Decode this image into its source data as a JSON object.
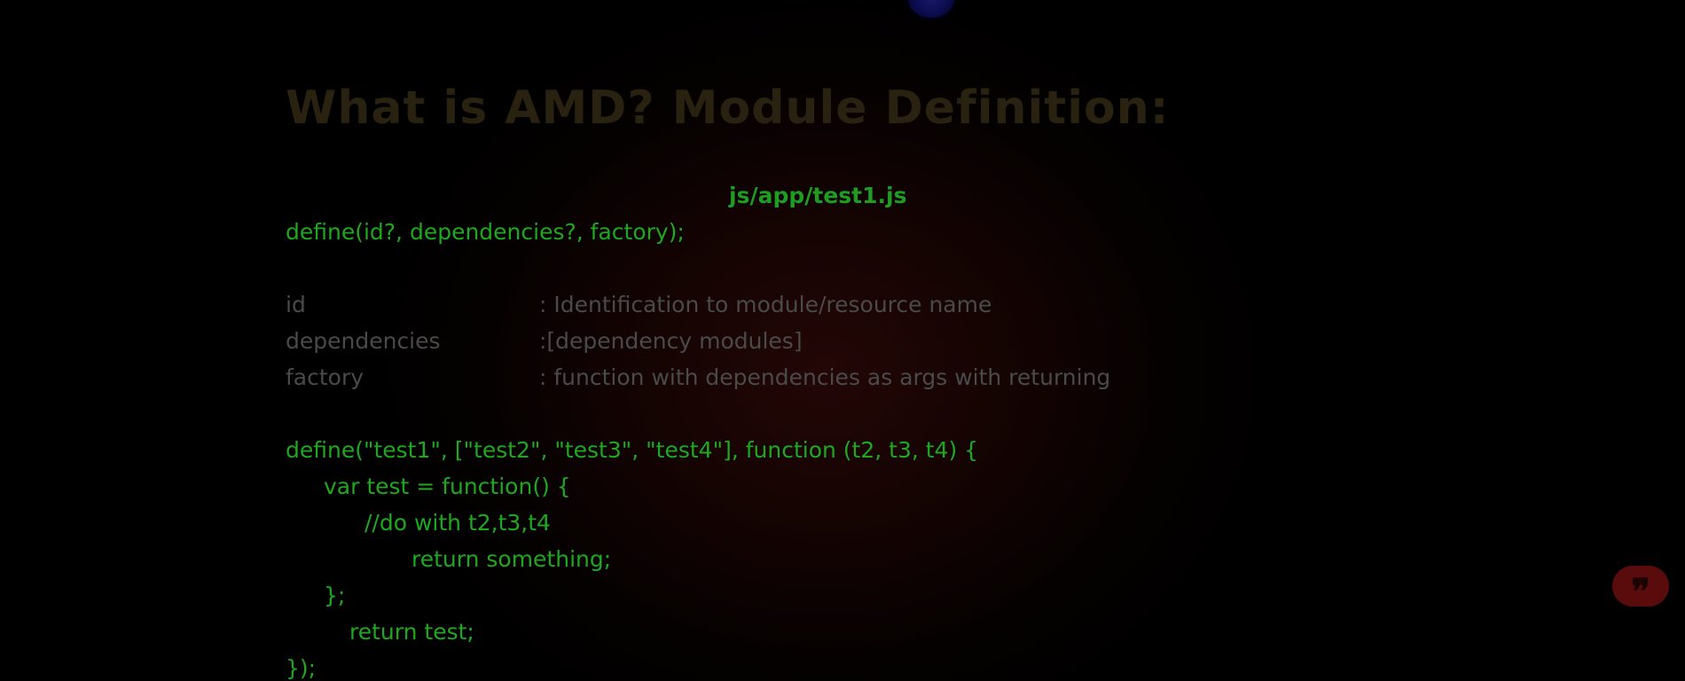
{
  "slide": {
    "title": "What is AMD? Module Definition:",
    "file_name": "js/app/test1.js",
    "signature": "define(id?, dependencies?, factory);",
    "params": [
      {
        "name": "id",
        "desc": ": Identification to module/resource name"
      },
      {
        "name": "dependencies",
        "desc": ":[dependency modules]"
      },
      {
        "name": "factory",
        "desc": ": function with dependencies as args with returning"
      }
    ],
    "code_lines": [
      "define(\"test1\", [\"test2\", \"test3\", \"test4\"], function (t2, t3, t4) {",
      "var test = function() {",
      "//do with t2,t3,t4",
      "return something;",
      "};",
      "return test;",
      "});"
    ]
  },
  "colors": {
    "code": "#1fa81f",
    "description": "#4a4a4a",
    "title": "#2a2210",
    "quote_button": "#5a0c0c"
  },
  "icons": {
    "quote_button": "quote-icon",
    "top_indicator": "dot-indicator-icon"
  },
  "quote_button": {
    "glyph": "❞"
  }
}
